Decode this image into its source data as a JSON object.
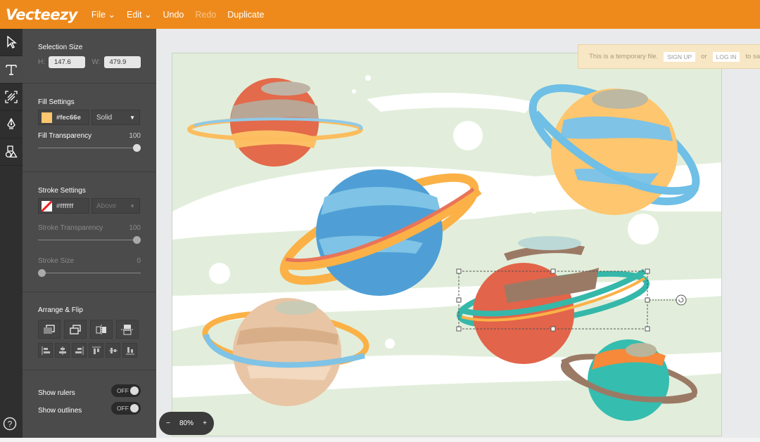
{
  "header": {
    "logo": "Vecteezy",
    "menu": [
      {
        "label": "File",
        "dropdown": true
      },
      {
        "label": "Edit",
        "dropdown": true
      },
      {
        "label": "Undo",
        "enabled": true
      },
      {
        "label": "Redo",
        "enabled": false
      },
      {
        "label": "Duplicate",
        "enabled": true
      }
    ]
  },
  "tools": [
    "select-arrow-icon",
    "text-icon",
    "pattern-icon",
    "pen-icon",
    "shapes-icon"
  ],
  "panel": {
    "selection": {
      "title": "Selection Size",
      "h_label": "H:",
      "h_value": "147.6",
      "w_label": "W:",
      "w_value": "479.9"
    },
    "fill": {
      "title": "Fill Settings",
      "color": "#fec66e",
      "color_label": "#fec66e",
      "type": "Solid",
      "transparency_label": "Fill Transparency",
      "transparency": 100
    },
    "stroke": {
      "title": "Stroke Settings",
      "color_label": "#ffffff",
      "position": "Above",
      "transparency_label": "Stroke Transparency",
      "transparency": 100,
      "size_label": "Stroke Size",
      "size": 0
    },
    "arrange": {
      "title": "Arrange & Flip"
    },
    "show_rulers": {
      "label": "Show rulers",
      "state": "OFF"
    },
    "show_outlines": {
      "label": "Show outlines",
      "state": "OFF"
    }
  },
  "notice": {
    "text": "This is a temporary file.",
    "signup": "SIGN UP",
    "or": "or",
    "login": "LOG IN",
    "tail": "to sav"
  },
  "zoom": {
    "minus": "−",
    "level": "80%",
    "plus": "+"
  },
  "colors": {
    "brand": "#ee8a1c",
    "panel": "#4b4b4b",
    "artboard": "#e2eedb"
  }
}
